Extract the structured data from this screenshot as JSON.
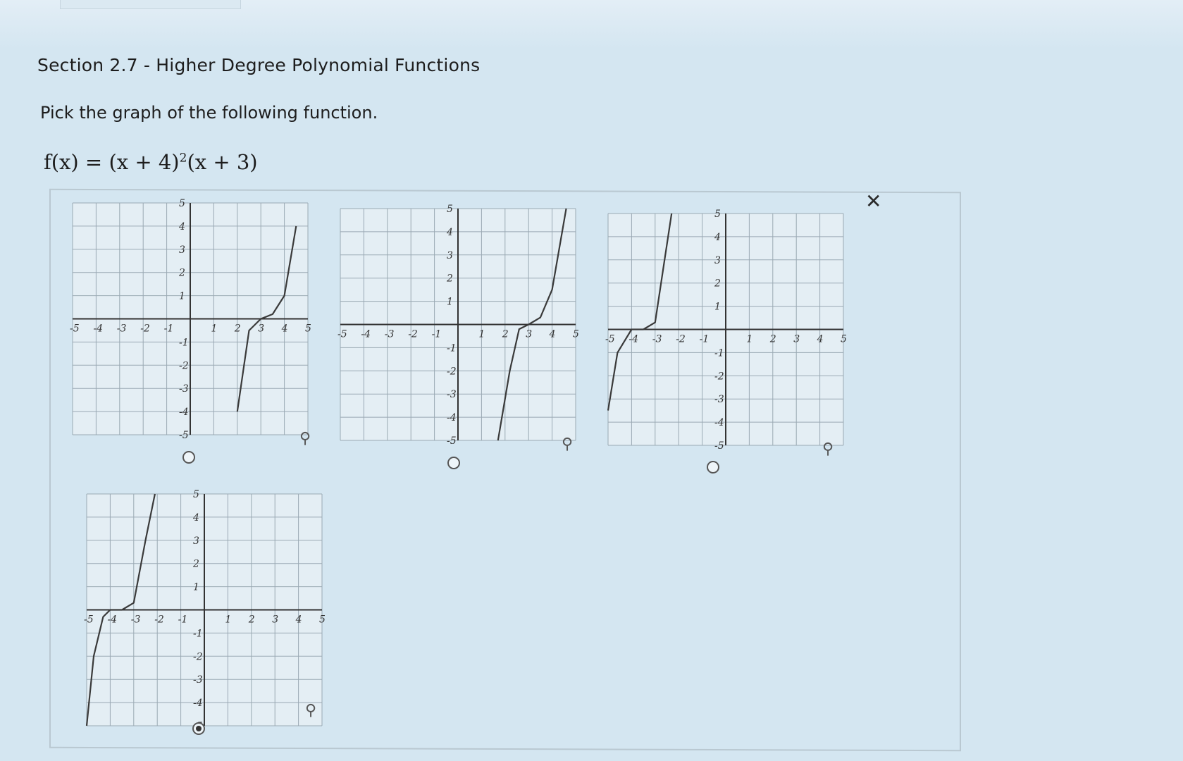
{
  "header": {
    "section_title": "Section 2.7 - Higher Degree Polynomial Functions",
    "prompt": "Pick the graph of the following function.",
    "formula": {
      "lhs": "f(x) = ",
      "base1": "(x + 4)",
      "exp": "2",
      "rest": "(x + 3)"
    }
  },
  "feedback_icon": "✕",
  "icons": {
    "zoom": "magnifier-icon",
    "feedback": "close-icon"
  },
  "axes": {
    "x_ticks": [
      "-5",
      "-4",
      "-3",
      "-2",
      "-1",
      "1",
      "2",
      "3",
      "4",
      "5"
    ],
    "y_ticks": [
      "5",
      "4",
      "3",
      "2",
      "1",
      "-1",
      "-2",
      "-3",
      "-4",
      "-5"
    ]
  },
  "options": [
    {
      "id": "a",
      "double_root": 3,
      "single_root": 2,
      "selected": false
    },
    {
      "id": "b",
      "double_root": 3,
      "single_root": 2,
      "selected": false
    },
    {
      "id": "c",
      "double_root": -4,
      "single_root": -3,
      "selected": false
    },
    {
      "id": "d",
      "double_root": -4,
      "single_root": -3,
      "selected": true
    }
  ],
  "chart_data": [
    {
      "type": "line",
      "xlim": [
        -5,
        5
      ],
      "ylim": [
        -5,
        5
      ],
      "grid": true,
      "series": [
        {
          "x": [
            2.0,
            2.5,
            3.0,
            3.5,
            4.0,
            4.5
          ],
          "y": [
            -4.0,
            -0.5,
            0.0,
            0.2,
            1.0,
            4.0
          ]
        }
      ]
    },
    {
      "type": "line",
      "xlim": [
        -5,
        5
      ],
      "ylim": [
        -5,
        5
      ],
      "grid": true,
      "series": [
        {
          "x": [
            1.7,
            2.2,
            2.6,
            3.0,
            3.5,
            4.0,
            4.6
          ],
          "y": [
            -5.0,
            -2.0,
            -0.2,
            0.0,
            0.3,
            1.5,
            5.0
          ]
        }
      ]
    },
    {
      "type": "line",
      "xlim": [
        -5,
        5
      ],
      "ylim": [
        -5,
        5
      ],
      "grid": true,
      "series": [
        {
          "x": [
            -5.0,
            -4.6,
            -4.0,
            -3.5,
            -3.0,
            -2.6,
            -2.3
          ],
          "y": [
            -3.5,
            -1.0,
            0.0,
            0.0,
            0.3,
            3.0,
            5.0
          ]
        }
      ]
    },
    {
      "type": "line",
      "xlim": [
        -5,
        5
      ],
      "ylim": [
        -5,
        5
      ],
      "grid": true,
      "series": [
        {
          "x": [
            -5.0,
            -4.7,
            -4.3,
            -4.0,
            -3.5,
            -3.0,
            -2.5,
            -2.1
          ],
          "y": [
            -5.0,
            -2.0,
            -0.3,
            0.0,
            0.0,
            0.3,
            3.0,
            5.0
          ]
        }
      ]
    }
  ]
}
